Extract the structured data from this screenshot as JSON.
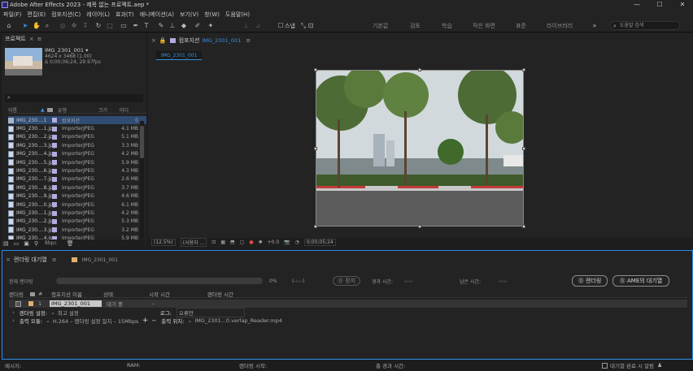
{
  "window": {
    "title": "Adobe After Effects 2023 - 제목 없는 프로젝트.aep *"
  },
  "menu": [
    "파일(F)",
    "편집(E)",
    "컴포지션(C)",
    "레이어(L)",
    "효과(T)",
    "애니메이션(A)",
    "보기(V)",
    "창(W)",
    "도움말(H)"
  ],
  "toolbar": {
    "snap_label": "스냅",
    "workspaces": [
      "기본값",
      "검토",
      "학습",
      "작은 화면",
      "표준",
      "라이브러리"
    ],
    "search_placeholder": "도움말 검색"
  },
  "project": {
    "tab": "프로젝트",
    "preview": {
      "name": "IMG_2301_001 ▾",
      "dims": "4624 x 3468 (1.00)",
      "duration": "Δ 0;00;06;24, 29.97fps"
    },
    "search_icon": "search-icon",
    "columns": {
      "name": "이름",
      "type": "유형",
      "size": "크기",
      "media": "미디"
    },
    "comp_row": {
      "name": "IMG_230....1",
      "type": "컴포지션",
      "size": "0"
    },
    "files": [
      {
        "name": "IMG_230....1.jpg",
        "type": "ImporterJPEG",
        "size": "4.1 MB"
      },
      {
        "name": "IMG_230....2.jpg",
        "type": "ImporterJPEG",
        "size": "5.1 MB"
      },
      {
        "name": "IMG_230....3.jpg",
        "type": "ImporterJPEG",
        "size": "3.3 MB"
      },
      {
        "name": "IMG_230....4.jpg",
        "type": "ImporterJPEG",
        "size": "4.2 MB"
      },
      {
        "name": "IMG_230....5.jpg",
        "type": "ImporterJPEG",
        "size": "5.9 MB"
      },
      {
        "name": "IMG_230....6.jpg",
        "type": "ImporterJPEG",
        "size": "4.3 MB"
      },
      {
        "name": "IMG_230....7.jpg",
        "type": "ImporterJPEG",
        "size": "2.6 MB"
      },
      {
        "name": "IMG_230....8.jpg",
        "type": "ImporterJPEG",
        "size": "3.7 MB"
      },
      {
        "name": "IMG_230....9.jpg",
        "type": "ImporterJPEG",
        "size": "4.6 MB"
      },
      {
        "name": "IMG_230....0.jpg",
        "type": "ImporterJPEG",
        "size": "6.1 MB"
      },
      {
        "name": "IMG_230....1.jpg",
        "type": "ImporterJPEG",
        "size": "4.2 MB"
      },
      {
        "name": "IMG_230....2.jpg",
        "type": "ImporterJPEG",
        "size": "5.3 MB"
      },
      {
        "name": "IMG_230....3.jpg",
        "type": "ImporterJPEG",
        "size": "3.2 MB"
      },
      {
        "name": "IMG_230....4.jpg",
        "type": "ImporterJPEG",
        "size": "5.9 MB"
      }
    ],
    "bpc": "8bpc"
  },
  "composition": {
    "tab_label": "컴포지션",
    "tab_name": "IMG_2301_001",
    "breadcrumb": "IMG_2301_001",
    "viewer": {
      "zoom": "(12.5%)",
      "resolution": "(사용자 ...",
      "exposure": "+0.0",
      "timecode": "0;00;05;24"
    }
  },
  "render_queue": {
    "tab": "렌더링 대기열",
    "comp_tab": "IMG_2301_001",
    "current_render": "현재 렌더링",
    "progress_pct": "0%",
    "elapsed_placeholder": "(-:-:-)",
    "stop_label": "정지",
    "elapsed_label": "경과 시간:",
    "elapsed_value": "-:-:-",
    "remaining_label": "남은 시간:",
    "remaining_value": "-:-:-",
    "render_button": "렌더링",
    "ame_button": "AME의 대기열",
    "columns": {
      "render": "렌더링",
      "tag": "#",
      "comp": "컴포지션 이름",
      "status": "상태",
      "start": "시작 시간",
      "time": "렌더링 시간"
    },
    "item": {
      "num": "1",
      "comp": "IMG_2301_001",
      "status": "대기 중",
      "start": "–"
    },
    "render_settings_label": "렌더링 설정:",
    "render_settings_value": "최고 설정",
    "log_label": "로그:",
    "log_value": "오류만",
    "output_module_label": "출력 모듈:",
    "output_module_value": "H.264 – 렌더링 설정 일치 – 15Mbps",
    "output_to_label": "출력 위치:",
    "output_to_value": "IMG_2301...0.verlap_Reader.mp4"
  },
  "status": {
    "message": "메시지:",
    "ram": "RAM:",
    "render_start": "렌더링 시작:",
    "total_elapsed": "총 경과 시간:",
    "notify": "대기열 완료 시 알림"
  }
}
